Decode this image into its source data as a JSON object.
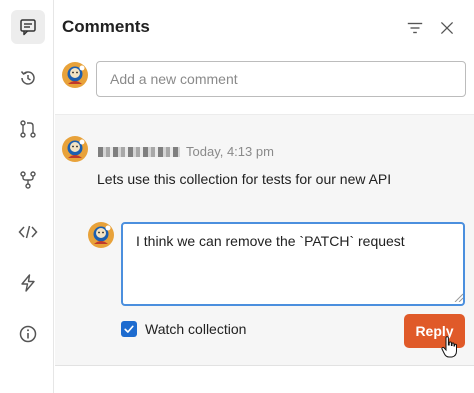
{
  "sidebar": {
    "items": [
      {
        "icon": "comment-icon",
        "active": true
      },
      {
        "icon": "history-icon",
        "active": false
      },
      {
        "icon": "pull-request-icon",
        "active": false
      },
      {
        "icon": "fork-icon",
        "active": false
      },
      {
        "icon": "code-icon",
        "active": false
      },
      {
        "icon": "lightning-icon",
        "active": false
      },
      {
        "icon": "info-icon",
        "active": false
      }
    ]
  },
  "header": {
    "title": "Comments",
    "filter_icon": "filter-icon",
    "close_icon": "close-icon"
  },
  "new_comment": {
    "placeholder": "Add a new comment"
  },
  "thread": {
    "comment": {
      "author": "",
      "timestamp": "Today, 4:13 pm",
      "text": "Lets use this collection for tests for our new API"
    },
    "reply": {
      "value": "I think we can remove the `PATCH` request"
    },
    "watch": {
      "label": "Watch collection",
      "checked": true
    },
    "reply_button": "Reply"
  },
  "colors": {
    "accent_orange": "#e05a29",
    "focus_blue": "#4b8fde",
    "checkbox_blue": "#1d6bcf"
  }
}
